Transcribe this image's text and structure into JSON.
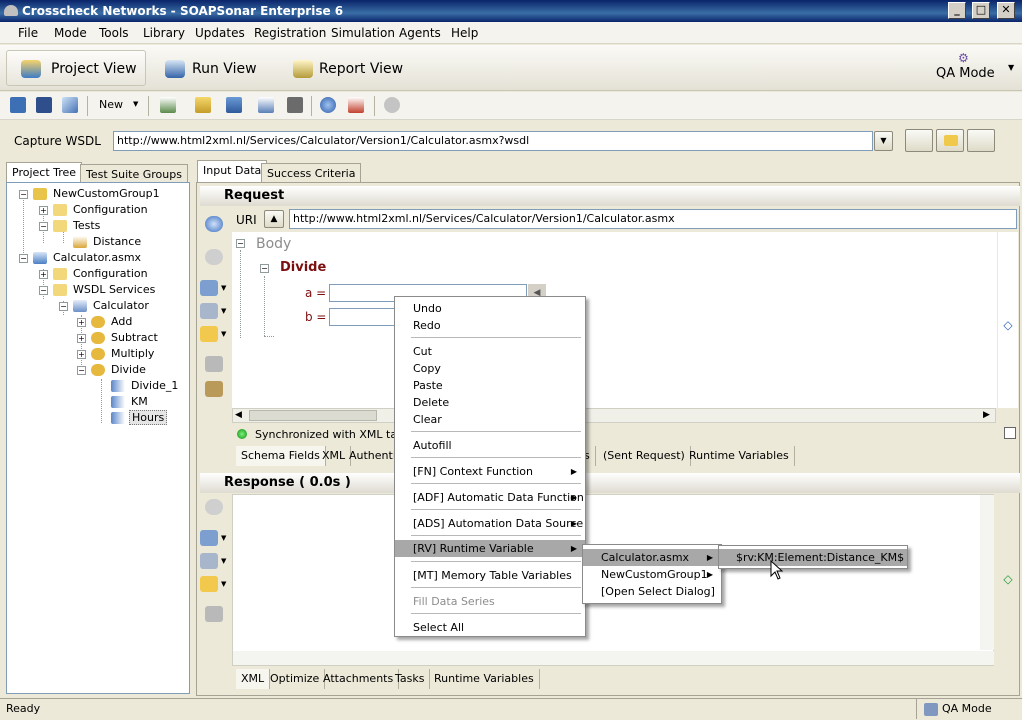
{
  "window": {
    "title": "Crosscheck Networks - SOAPSonar Enterprise 6"
  },
  "menubar": [
    "File",
    "Mode",
    "Tools",
    "Library",
    "Updates",
    "Registration",
    "Simulation",
    "Agents",
    "Help"
  ],
  "views": {
    "project": "Project View",
    "run": "Run View",
    "report": "Report View",
    "qa_mode": "QA Mode"
  },
  "toolbar": {
    "new_label": "New"
  },
  "capture": {
    "label": "Capture WSDL",
    "url": "http://www.html2xml.nl/Services/Calculator/Version1/Calculator.asmx?wsdl"
  },
  "left_tabs": [
    "Project Tree",
    "Test Suite Groups"
  ],
  "tree": {
    "group": "NewCustomGroup1",
    "config1": "Configuration",
    "tests": "Tests",
    "distance": "Distance",
    "calc": "Calculator.asmx",
    "config2": "Configuration",
    "wsdl": "WSDL Services",
    "calculator": "Calculator",
    "add": "Add",
    "subtract": "Subtract",
    "multiply": "Multiply",
    "divide": "Divide",
    "divide1": "Divide_1",
    "km": "KM",
    "hours": "Hours"
  },
  "right_tabs": [
    "Input Data",
    "Success Criteria"
  ],
  "request": {
    "header": "Request",
    "uri_label": "URI",
    "uri": "http://www.html2xml.nl/Services/Calculator/Version1/Calculator.asmx",
    "body_label": "Body",
    "operation": "Divide",
    "field_a": "a =",
    "field_b": "b =",
    "sync_text": "Synchronized with XML tab",
    "tabs": [
      "Schema Fields",
      "XML",
      "Authentic",
      "s",
      "(Sent Request)",
      "Runtime Variables"
    ]
  },
  "response": {
    "header": "Response ( 0.0s )",
    "tabs": [
      "XML",
      "Optimize",
      "Attachments",
      "Tasks",
      "Runtime Variables"
    ]
  },
  "context_menu": {
    "items": [
      "Undo",
      "Redo",
      "Cut",
      "Copy",
      "Paste",
      "Delete",
      "Clear",
      "Autofill",
      "[FN] Context Function",
      "[ADF] Automatic Data Function",
      "[ADS] Automation Data Source",
      "[RV] Runtime Variable",
      "[MT] Memory Table Variables",
      "Fill Data Series",
      "Select All"
    ]
  },
  "submenu1": {
    "items": [
      "Calculator.asmx",
      "NewCustomGroup1",
      "[Open Select Dialog]"
    ]
  },
  "submenu2": {
    "items": [
      "$rv:KM:Element:Distance_KM$"
    ]
  },
  "status": {
    "left": "Ready",
    "right": "QA Mode"
  }
}
